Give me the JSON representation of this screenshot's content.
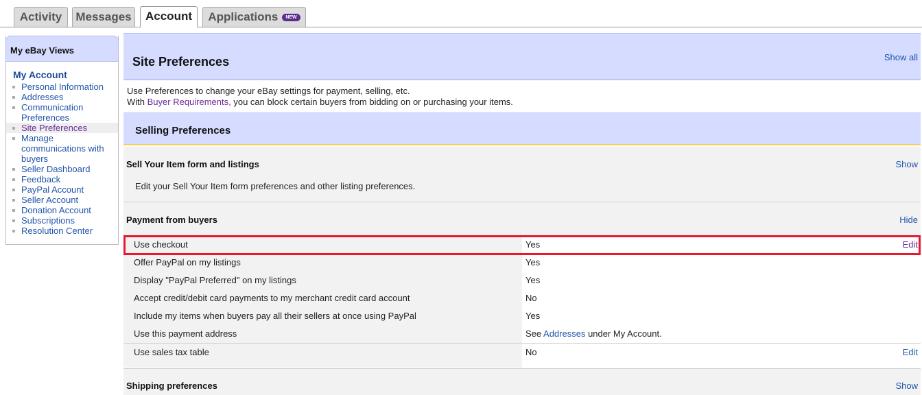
{
  "tabs": [
    {
      "label": "Activity"
    },
    {
      "label": "Messages"
    },
    {
      "label": "Account"
    },
    {
      "label": "Applications",
      "badge": "NEW"
    }
  ],
  "sidebar": {
    "header": "My eBay Views",
    "title": "My Account",
    "items": [
      {
        "label": "Personal Information"
      },
      {
        "label": "Addresses"
      },
      {
        "label": "Communication Preferences"
      },
      {
        "label": "Site Preferences"
      },
      {
        "label": "Manage communications with buyers"
      },
      {
        "label": "Seller Dashboard"
      },
      {
        "label": "Feedback"
      },
      {
        "label": "PayPal Account"
      },
      {
        "label": "Seller Account"
      },
      {
        "label": "Donation Account"
      },
      {
        "label": "Subscriptions"
      },
      {
        "label": "Resolution Center"
      }
    ]
  },
  "main": {
    "title": "Site Preferences",
    "show_all": "Show all",
    "intro_line1": "Use Preferences to change your eBay settings for payment, selling, etc.",
    "intro_with": "With ",
    "intro_link": "Buyer Requirements,",
    "intro_rest": " you can block certain buyers from bidding on or purchasing your items.",
    "selling_title": "Selling Preferences",
    "sell_form": {
      "title": "Sell Your Item form and listings",
      "action": "Show",
      "desc": "Edit your Sell Your Item form preferences and other listing preferences."
    },
    "payment": {
      "title": "Payment from buyers",
      "action": "Hide"
    },
    "rows": [
      {
        "label": "Use checkout",
        "value": "Yes",
        "edit": "Edit"
      },
      {
        "label": "Offer PayPal on my listings",
        "value": "Yes"
      },
      {
        "label": "Display \"PayPal Preferred\" on my listings",
        "value": "Yes"
      },
      {
        "label": "Accept credit/debit card payments to my merchant credit card account",
        "value": "No"
      },
      {
        "label": "Include my items when buyers pay all their sellers at once using PayPal",
        "value": "Yes"
      },
      {
        "label": "Use this payment address",
        "value_pre": "See ",
        "value_link": "Addresses",
        "value_post": " under My Account."
      },
      {
        "label": "Use sales tax table",
        "value": "No",
        "edit": "Edit"
      }
    ],
    "shipping": {
      "title": "Shipping preferences",
      "action": "Show"
    }
  },
  "colors": {
    "header_bg": "#d6dcff",
    "link": "#2255aa",
    "visited": "#6a2c9a",
    "highlight": "#e8192c"
  }
}
